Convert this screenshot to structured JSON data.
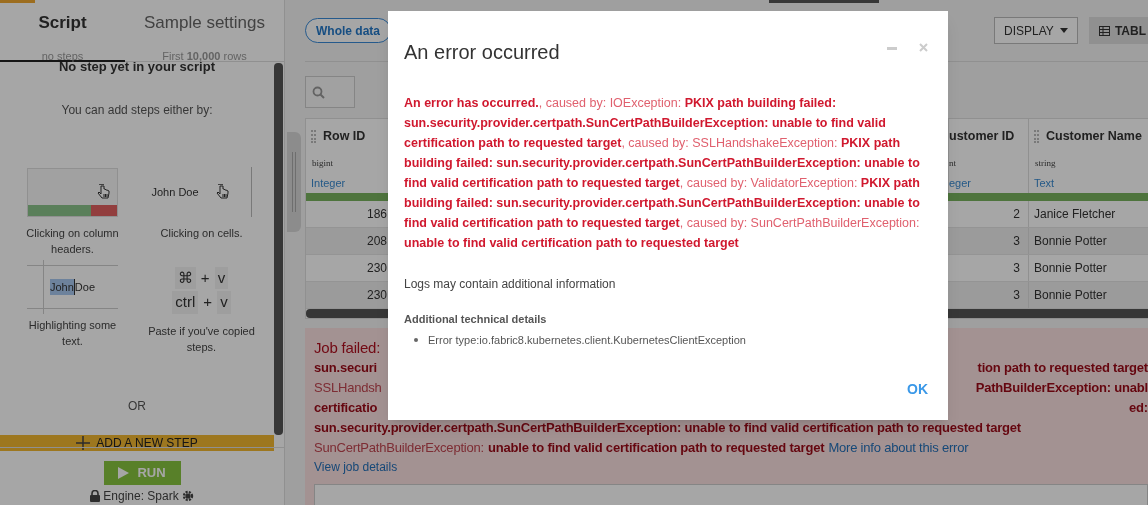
{
  "tabs": [
    {
      "label": "Script",
      "sublabel": "no steps",
      "selected": true
    },
    {
      "label": "Sample settings",
      "sublabel": "First **10,000** rows",
      "selected": false
    }
  ],
  "script_panel": {
    "heading": "No step yet in your script",
    "intro": "You can add steps either by:",
    "methods": [
      {
        "kind": "header",
        "caption": "Clicking on column headers."
      },
      {
        "kind": "cell",
        "sample": "John Doe",
        "caption": "Clicking on cells."
      },
      {
        "kind": "highlight",
        "sample": [
          "John",
          "Doe"
        ],
        "caption": "Highlighting some text."
      },
      {
        "kind": "paste",
        "keys": [
          [
            "⌘",
            "+",
            "v"
          ],
          [
            "ctrl",
            "+",
            "v"
          ]
        ],
        "caption": "Paste if you've copied steps."
      }
    ],
    "or": "OR",
    "add_step": "ADD A NEW STEP"
  },
  "run_button": "RUN",
  "engine": "Engine: Spark",
  "toolbar": {
    "sample_button": "Whole data",
    "display_button": "DISPLAY",
    "table_button": "TABL"
  },
  "table": {
    "columns": [
      {
        "name": "Row ID",
        "storage": "bigint",
        "meaning": "Integer"
      },
      {
        "name": "ustomer ID",
        "storage": "nt",
        "meaning": "eger"
      },
      {
        "name": "Customer Name",
        "storage": "string",
        "meaning": "Text"
      }
    ],
    "rows": [
      [
        "186",
        "2",
        "Janice Fletcher"
      ],
      [
        "208",
        "3",
        "Bonnie Potter"
      ],
      [
        "230",
        "3",
        "Bonnie Potter"
      ],
      [
        "230",
        "3",
        "Bonnie Potter"
      ]
    ]
  },
  "job_error": {
    "lines": [
      {
        "left": [
          {
            "kind": "title",
            "text": "Job failed:"
          }
        ]
      },
      {
        "left": [
          {
            "kind": "detail",
            "text": "sun.securi"
          }
        ],
        "right": [
          {
            "kind": "detail",
            "text": "tion path to requested target"
          }
        ]
      },
      {
        "left": [
          {
            "kind": "cause",
            "text": "SSLHandsh"
          }
        ],
        "right": [
          {
            "kind": "detail",
            "text": "PathBuilderException: unabl"
          }
        ]
      },
      {
        "left": [
          {
            "kind": "detail",
            "text": "certificatio"
          }
        ],
        "right": [
          {
            "kind": "detail",
            "text": "ed:"
          }
        ]
      },
      {
        "left": [
          {
            "kind": "detail",
            "text": "sun.security.provider.certpath.SunCertPathBuilderException: unable to find valid certification path to requested target"
          }
        ]
      },
      {
        "left": [
          {
            "kind": "cause",
            "text": "SunCertPathBuilderException:"
          },
          {
            "kind": "detail",
            "text": "unable to find valid certification path to requested target"
          },
          {
            "kind": "link",
            "text": "More info about this error"
          }
        ]
      }
    ],
    "details_link": "View job details"
  },
  "dialog": {
    "title": "An error occurred",
    "message": "**An error has occurred.**, caused by: IOException: **PKIX path building failed: sun.security.provider.certpath.SunCertPathBuilderException: unable to find valid certification path to requested target**, caused by: SSLHandshakeException: **PKIX path building failed: sun.security.provider.certpath.SunCertPathBuilderException: unable to find valid certification path to requested target**, caused by: ValidatorException: **PKIX path building failed: sun.security.provider.certpath.SunCertPathBuilderException: unable to find valid certification path to requested target**, caused by: SunCertPathBuilderException: **unable to find valid certification path to requested target**",
    "logs_note": "Logs may contain additional information",
    "details_heading": "Additional technical details",
    "details": [
      "Error type:io.fabric8.kubernetes.client.KubernetesClientException"
    ],
    "ok_button": "OK"
  }
}
